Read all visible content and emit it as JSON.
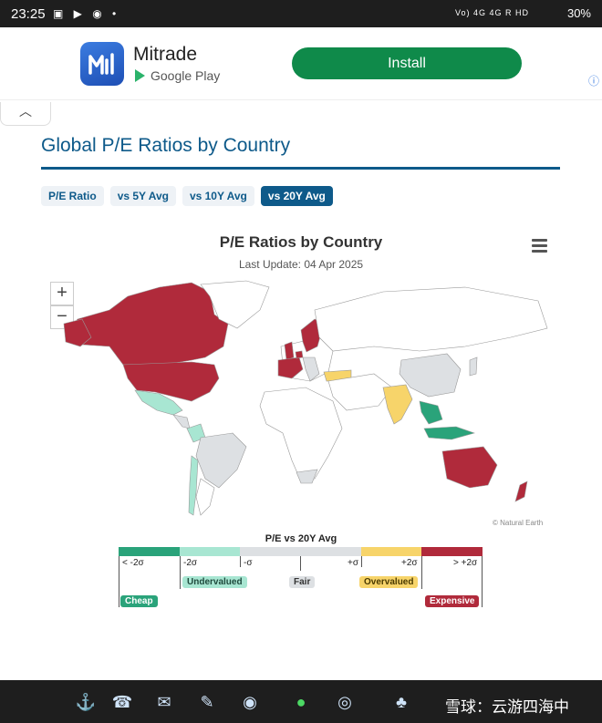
{
  "status_bar": {
    "time": "23:25",
    "battery": "30%",
    "network": "Vo) 4G 4G R HD"
  },
  "ad": {
    "brand": "Mitrade",
    "store": "Google Play",
    "install_label": "Install"
  },
  "page": {
    "title": "Global P/E Ratios by Country",
    "tabs": [
      "P/E Ratio",
      "vs 5Y Avg",
      "vs 10Y Avg",
      "vs 20Y Avg"
    ],
    "active_tab": "vs 20Y Avg"
  },
  "chart_data": {
    "type": "choropleth",
    "title": "P/E Ratios by Country",
    "subtitle": "Last Update: 04 Apr 2025",
    "credit": "© Natural Earth",
    "legend": {
      "title": "P/E vs 20Y Avg",
      "bins": [
        "< -2σ",
        "-2σ",
        "-σ",
        "+σ",
        "+2σ",
        "> +2σ"
      ],
      "bands": [
        "Undervalued",
        "Fair",
        "Overvalued"
      ],
      "extremes": [
        "Cheap",
        "Expensive"
      ]
    },
    "colors": {
      "cheap": "#2aa37a",
      "undervalued": "#a8e6d2",
      "fair": "#dde0e3",
      "overvalued": "#f7d46a",
      "expensive": "#b02a3b"
    },
    "countries": {
      "expensive": [
        "Canada",
        "United States",
        "Australia",
        "New Zealand",
        "United Kingdom",
        "Spain",
        "France",
        "Sweden",
        "Norway",
        "Finland",
        "Denmark",
        "Netherlands"
      ],
      "overvalued": [
        "India",
        "Turkey"
      ],
      "undervalued": [
        "Mexico",
        "Colombia",
        "Chile"
      ],
      "cheap": [
        "Indonesia",
        "Malaysia",
        "Thailand"
      ],
      "fair": [
        "Brazil",
        "China",
        "Italy",
        "Germany",
        "South Africa",
        "Argentina",
        "Japan"
      ]
    }
  },
  "watermark": "雪球：云游四海中"
}
